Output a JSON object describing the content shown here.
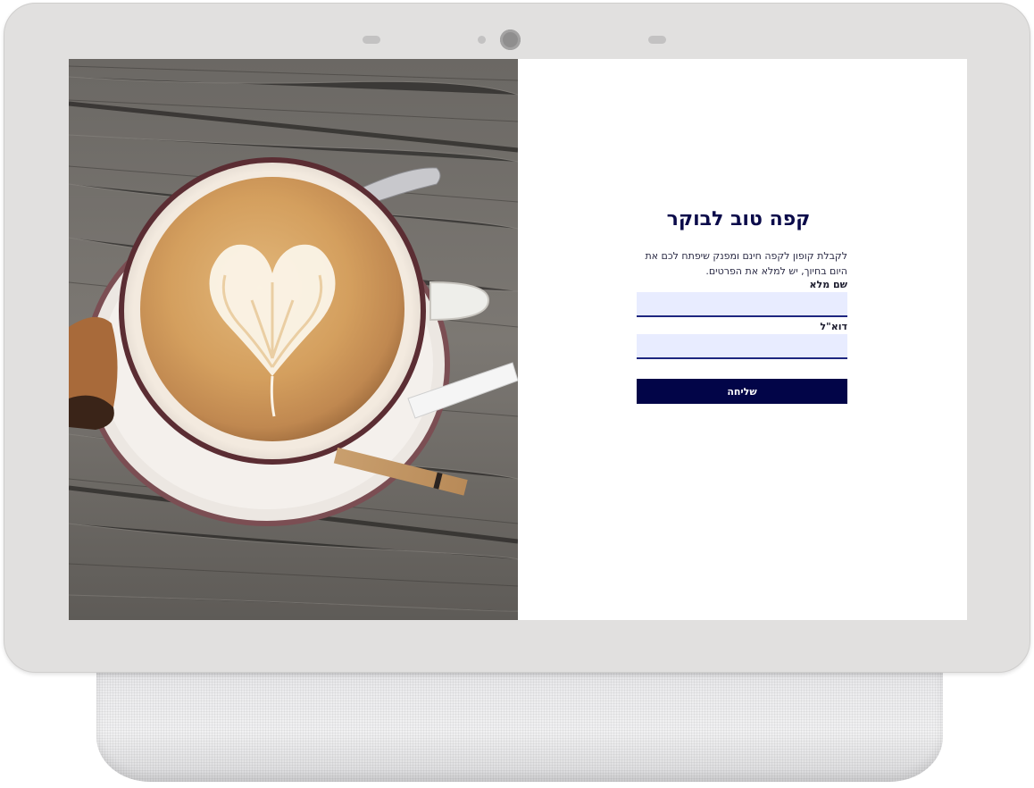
{
  "form": {
    "title": "קפה טוב לבוקר",
    "description": "לקבלת קופון לקפה חינם ומפנק שיפתח לכם את היום בחיוך, יש למלא את הפרטים.",
    "name_label": "שם מלא",
    "name_value": "",
    "email_label": "דוא\"ל",
    "email_value": "",
    "submit_label": "שליחה"
  },
  "colors": {
    "title": "#0b0b4a",
    "button": "#020548",
    "field_bg": "#e8ecff",
    "field_border": "#1d2680"
  },
  "image": {
    "subject": "latte-art-coffee-cup-on-wooden-table"
  }
}
